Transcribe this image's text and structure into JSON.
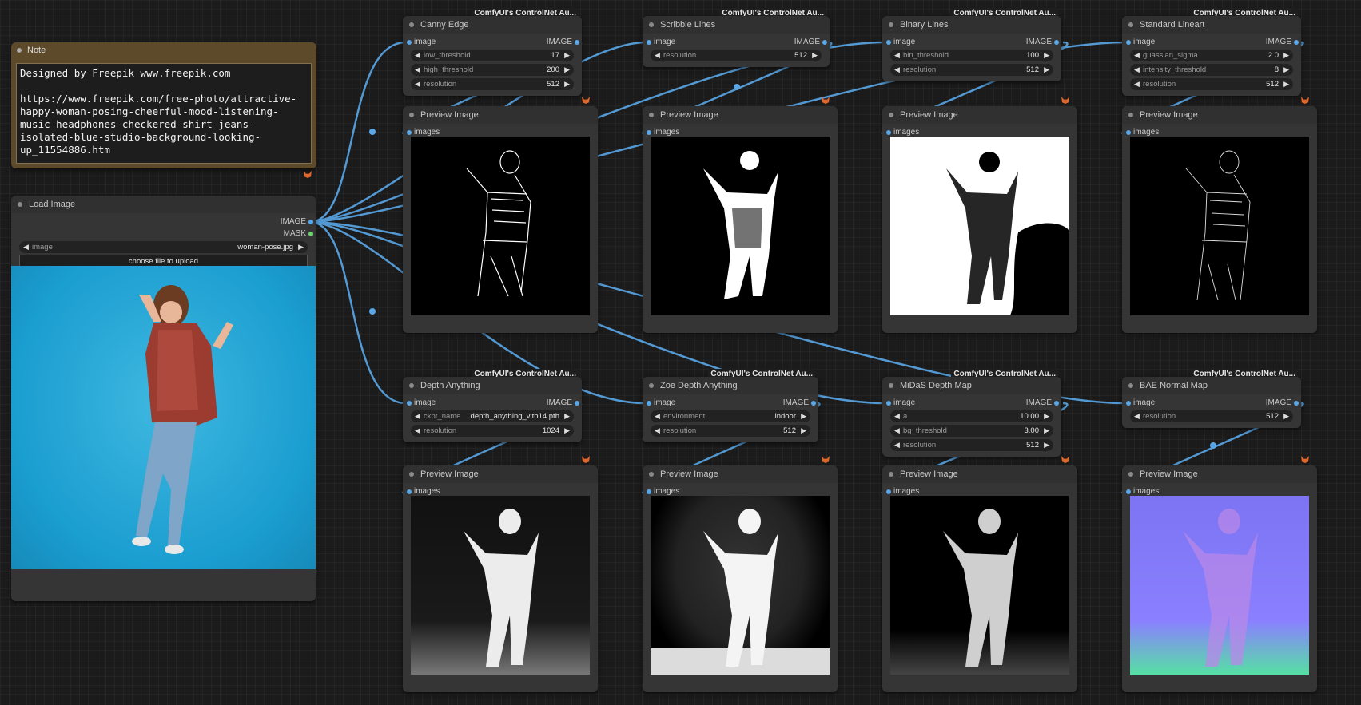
{
  "colors": {
    "canvas": "#1b1b1b",
    "node": "#353535",
    "wire": "#5aa7e8",
    "mask_dot": "#6fd36f",
    "note": "#5c4a2a",
    "badge_fox": "#e0662a"
  },
  "note": {
    "title": "Note",
    "text": "Designed by Freepik www.freepik.com\n\nhttps://www.freepik.com/free-photo/attractive-happy-woman-posing-cheerful-mood-listening-music-headphones-checkered-shirt-jeans-isolated-blue-studio-background-looking-up_11554886.htm"
  },
  "load_image": {
    "title": "Load Image",
    "out_image": "IMAGE",
    "out_mask": "MASK",
    "image_label": "image",
    "image_value": "woman-pose.jpg",
    "upload_button": "choose file to upload"
  },
  "badge": "ComfyUI's ControlNet Au...",
  "preview": {
    "title": "Preview Image",
    "input": "images"
  },
  "processors": [
    {
      "title": "Canny Edge",
      "in": "image",
      "out": "IMAGE",
      "widgets": [
        {
          "label": "low_threshold",
          "value": "17"
        },
        {
          "label": "high_threshold",
          "value": "200"
        },
        {
          "label": "resolution",
          "value": "512"
        }
      ]
    },
    {
      "title": "Scribble Lines",
      "in": "image",
      "out": "IMAGE",
      "widgets": [
        {
          "label": "resolution",
          "value": "512"
        }
      ]
    },
    {
      "title": "Binary Lines",
      "in": "image",
      "out": "IMAGE",
      "widgets": [
        {
          "label": "bin_threshold",
          "value": "100"
        },
        {
          "label": "resolution",
          "value": "512"
        }
      ]
    },
    {
      "title": "Standard Lineart",
      "in": "image",
      "out": "IMAGE",
      "widgets": [
        {
          "label": "guassian_sigma",
          "value": "2.0"
        },
        {
          "label": "intensity_threshold",
          "value": "8"
        },
        {
          "label": "resolution",
          "value": "512"
        }
      ]
    },
    {
      "title": "Depth Anything",
      "in": "image",
      "out": "IMAGE",
      "widgets": [
        {
          "label": "ckpt_name",
          "value": "depth_anything_vitb14.pth"
        },
        {
          "label": "resolution",
          "value": "1024"
        }
      ]
    },
    {
      "title": "Zoe Depth Anything",
      "in": "image",
      "out": "IMAGE",
      "widgets": [
        {
          "label": "environment",
          "value": "indoor"
        },
        {
          "label": "resolution",
          "value": "512"
        }
      ]
    },
    {
      "title": "MiDaS Depth Map",
      "in": "image",
      "out": "IMAGE",
      "widgets": [
        {
          "label": "a",
          "value": "10.00"
        },
        {
          "label": "bg_threshold",
          "value": "3.00"
        },
        {
          "label": "resolution",
          "value": "512"
        }
      ]
    },
    {
      "title": "BAE Normal Map",
      "in": "image",
      "out": "IMAGE",
      "widgets": [
        {
          "label": "resolution",
          "value": "512"
        }
      ]
    }
  ]
}
